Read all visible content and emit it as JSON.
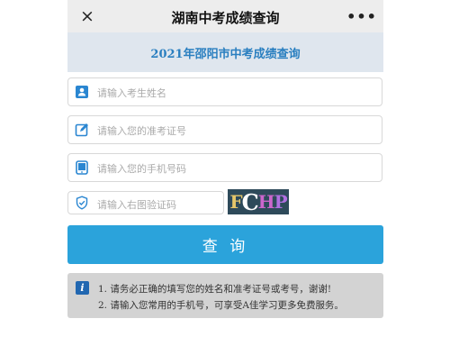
{
  "header": {
    "title": "湖南中考成绩查询",
    "close_icon": "×",
    "more_icon": "•••"
  },
  "banner": {
    "text": "2021年邵阳市中考成绩查询"
  },
  "form": {
    "name_placeholder": "请输入考生姓名",
    "ticket_placeholder": "请输入您的准考证号",
    "phone_placeholder": "请输入您的手机号码",
    "captcha_placeholder": "请输入右图验证码",
    "captcha_image_text": "FCHP"
  },
  "query_button": {
    "label": "查 询"
  },
  "notice": {
    "line1": "1. 请务必正确的填写您的姓名和准考证号或考号，谢谢!",
    "line2": "2. 请输入您常用的手机号，可享受A佳学习更多免费服务。"
  },
  "colors": {
    "accent": "#2ba3db",
    "banner_text": "#2a7fc0",
    "banner_bg": "#dfe6ee",
    "notice_bg": "#d3d3d3"
  }
}
